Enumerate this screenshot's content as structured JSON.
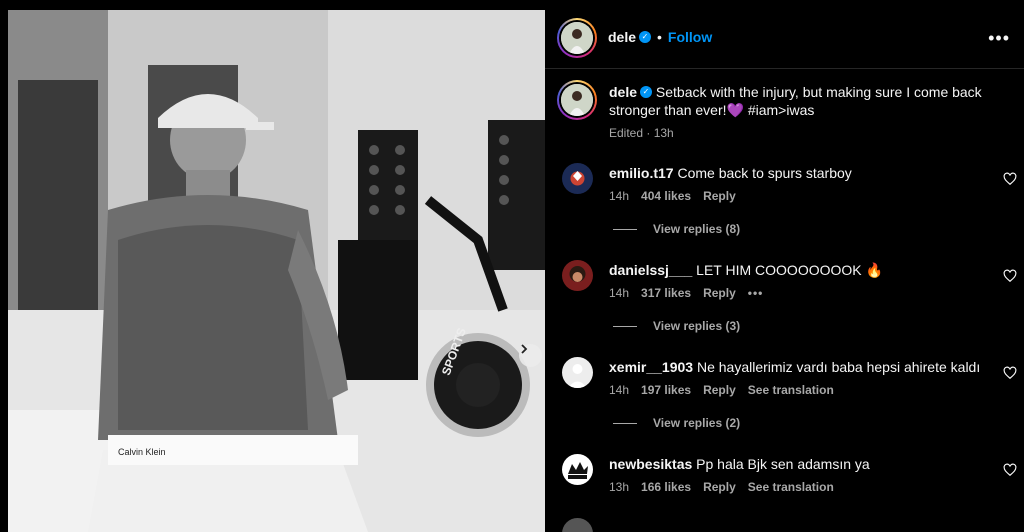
{
  "post": {
    "username": "dele",
    "follow_label": "Follow",
    "separator": "•",
    "more_label": "•••",
    "caption": "Setback with the injury, but making sure I come back stronger than ever!💜 #iam>iwas",
    "edited": "Edited · 13h"
  },
  "media": {
    "underwear_text": "Calvin Klein",
    "bike_text": "SPORTS"
  },
  "comments": [
    {
      "username": "emilio.t17",
      "text": "Come back to spurs starboy",
      "time": "14h",
      "likes": "404 likes",
      "reply": "Reply",
      "replies": "View replies (8)"
    },
    {
      "username": "danielssj___",
      "text": "LET HIM COOOOOOOOK 🔥",
      "time": "14h",
      "likes": "317 likes",
      "reply": "Reply",
      "extra": "•••",
      "replies": "View replies (3)"
    },
    {
      "username": "xemir__1903",
      "text": "Ne hayallerimiz vardı baba hepsi ahirete kaldı",
      "time": "14h",
      "likes": "197 likes",
      "reply": "Reply",
      "translate": "See translation",
      "replies": "View replies (2)"
    },
    {
      "username": "newbesiktas",
      "text": "Pp hala Bjk sen adamsın ya",
      "time": "13h",
      "likes": "166 likes",
      "reply": "Reply",
      "translate": "See translation"
    }
  ],
  "colors": {
    "accent": "#0095f6",
    "muted": "#a8a8a8",
    "background": "#000000"
  },
  "icons": [
    "verified-badge-icon",
    "more-options-icon",
    "heart-icon",
    "next-arrow-icon"
  ]
}
